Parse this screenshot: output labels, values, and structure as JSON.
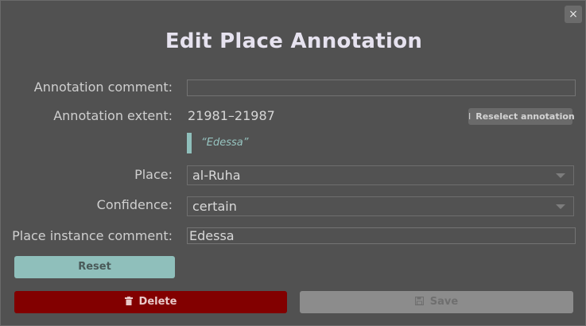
{
  "dialog": {
    "title": "Edit Place Annotation",
    "close_icon": "close-icon",
    "close_glyph": "×"
  },
  "form": {
    "annotation_comment": {
      "label": "Annotation comment:",
      "value": ""
    },
    "annotation_extent": {
      "label": "Annotation extent:",
      "value": "21981–21987",
      "reselect_label": "Reselect annotation",
      "reselect_icon": "text-cursor-icon",
      "reselect_glyph": "I"
    },
    "quote": "“Edessa”",
    "place": {
      "label": "Place:",
      "value": "al-Ruha",
      "icon": "chevron-down-icon"
    },
    "confidence": {
      "label": "Confidence:",
      "value": "certain",
      "icon": "chevron-down-icon"
    },
    "place_instance_comment": {
      "label": "Place instance comment:",
      "value": "Edessa"
    }
  },
  "buttons": {
    "reset": "Reset",
    "delete": "Delete",
    "delete_icon": "trash-icon",
    "delete_glyph": "🗑",
    "save": "Save",
    "save_icon": "floppy-disk-icon",
    "save_glyph": "💾"
  },
  "colors": {
    "background": "#515151",
    "accent_teal": "#8fbfbb",
    "delete_red": "#820000",
    "save_disabled": "#8c8c8c"
  }
}
